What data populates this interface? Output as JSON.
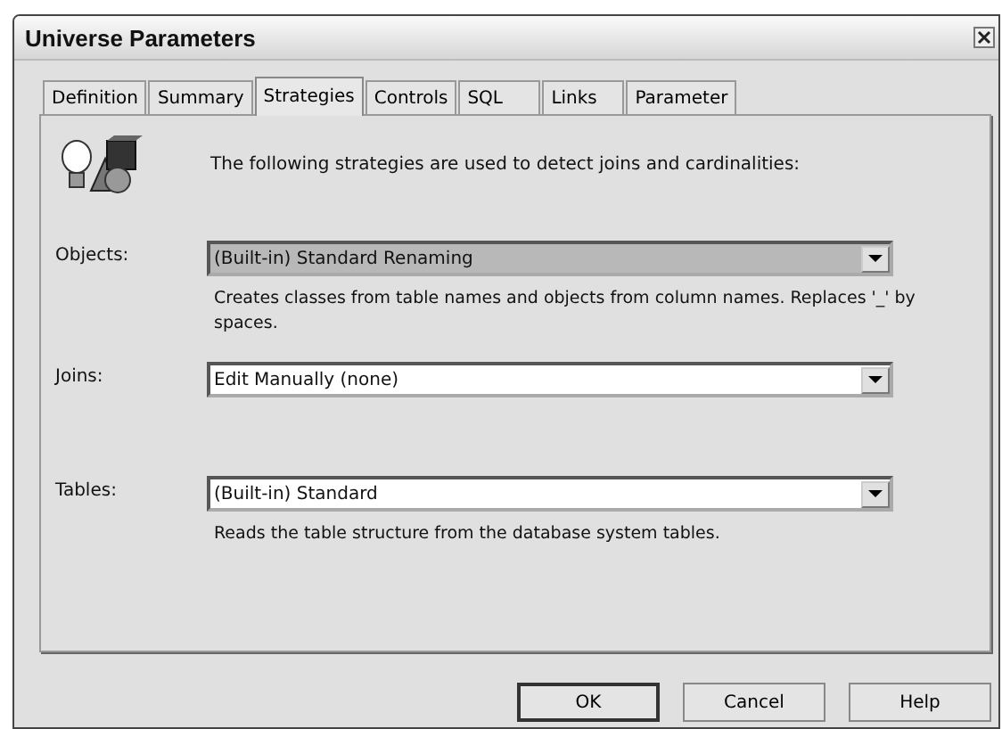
{
  "window": {
    "title": "Universe Parameters"
  },
  "tabs": [
    {
      "label": "Definition",
      "selected": false
    },
    {
      "label": "Summary",
      "selected": false
    },
    {
      "label": "Strategies",
      "selected": true
    },
    {
      "label": "Controls",
      "selected": false
    },
    {
      "label": "SQL",
      "selected": false
    },
    {
      "label": "Links",
      "selected": false
    },
    {
      "label": "Parameter",
      "selected": false
    }
  ],
  "intro": "The following strategies are used to detect joins and cardinalities:",
  "strategies": [
    {
      "label": "Objects:",
      "value": "(Built-in) Standard Renaming",
      "highlighted": true,
      "description": "Creates classes from table names and objects from column names. Replaces '_' by spaces."
    },
    {
      "label": "Joins:",
      "value": "Edit Manually (none)",
      "highlighted": false
    },
    {
      "label": "Tables:",
      "value": "(Built-in) Standard",
      "highlighted": false,
      "description": "Reads the table structure from the database system tables."
    }
  ],
  "buttons": [
    {
      "label": "OK",
      "default": true
    },
    {
      "label": "Cancel",
      "default": false
    },
    {
      "label": "Help",
      "default": false
    }
  ]
}
